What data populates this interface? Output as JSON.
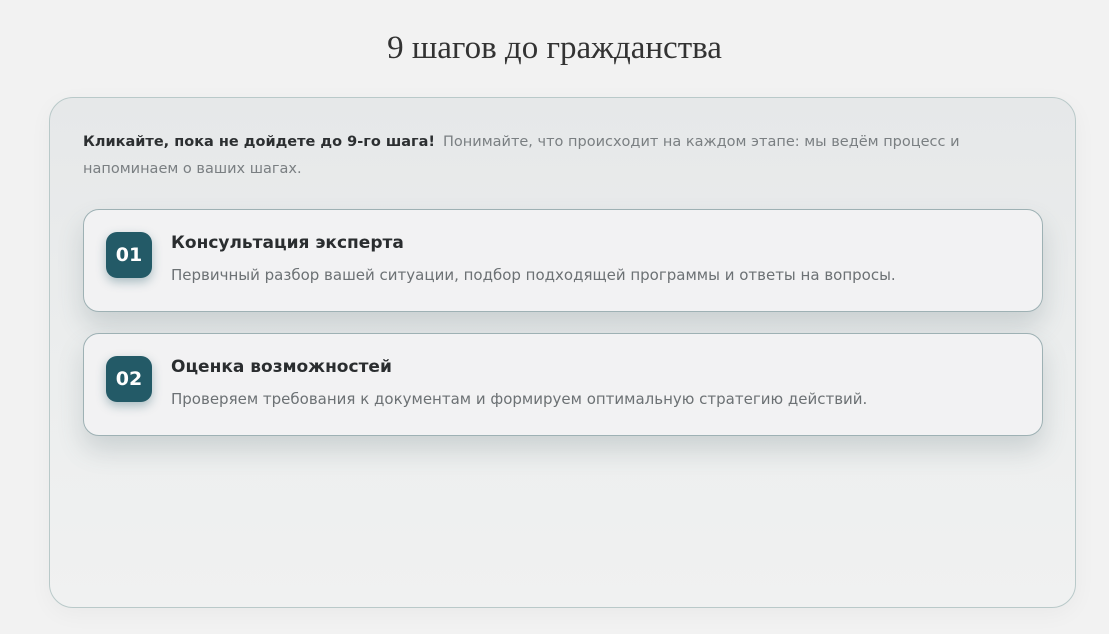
{
  "page": {
    "title": "9 шагов до гражданства"
  },
  "intro": {
    "bold": "Кликайте, пока не дойдете до 9-го шага!",
    "text": "Понимайте, что происходит на каждом этапе: мы ведём процесс и напоминаем о ваших шагах."
  },
  "steps": [
    {
      "number": "01",
      "title": "Консультация эксперта",
      "description": "Первичный разбор вашей ситуации, подбор подходящей программы и ответы на вопросы."
    },
    {
      "number": "02",
      "title": "Оценка возможностей",
      "description": "Проверяем требования к документам и формируем оптимальную стратегию действий."
    }
  ],
  "colors": {
    "accent": "#235a67",
    "background": "#f2f2f2"
  }
}
